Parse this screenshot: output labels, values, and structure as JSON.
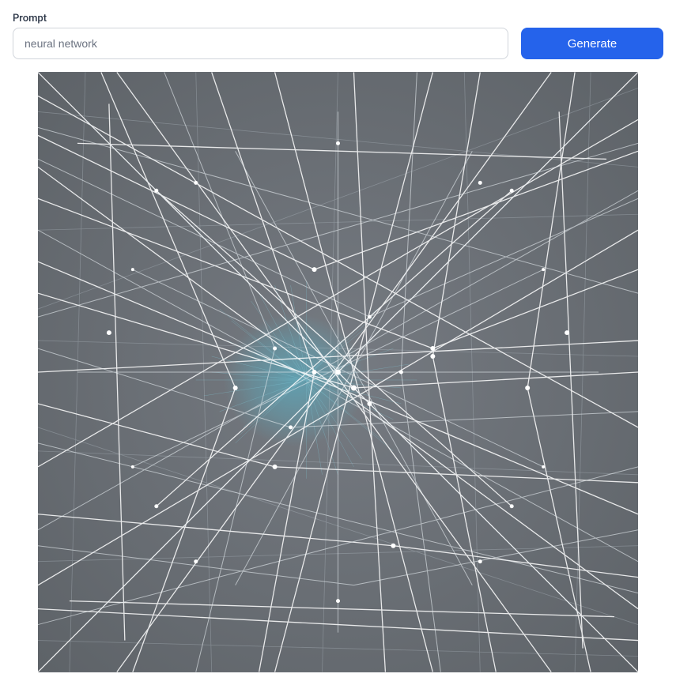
{
  "prompt": {
    "label": "Prompt",
    "value": "neural network"
  },
  "actions": {
    "generate_label": "Generate"
  },
  "colors": {
    "button_bg": "#2563eb",
    "button_text": "#ffffff",
    "image_bg": "#6b7077",
    "network_line": "#ffffff",
    "network_accent": "#5ab0c4"
  }
}
